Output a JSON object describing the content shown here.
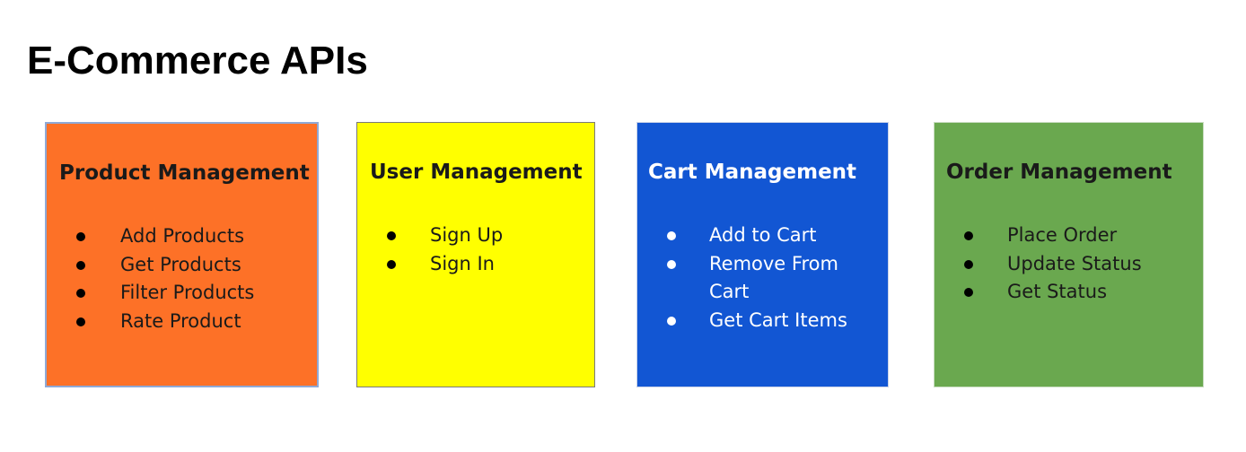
{
  "title": "E-Commerce APIs",
  "cards": [
    {
      "heading": "Product Management",
      "color": "#fd7127",
      "items": [
        "Add Products",
        "Get Products",
        "Filter Products",
        "Rate Product"
      ]
    },
    {
      "heading": "User Management",
      "color": "#ffff00",
      "items": [
        "Sign Up",
        "Sign In"
      ]
    },
    {
      "heading": "Cart Management",
      "color": "#1256d3",
      "items": [
        "Add to Cart",
        "Remove From Cart",
        "Get Cart Items"
      ]
    },
    {
      "heading": "Order Management",
      "color": "#6aa84f",
      "items": [
        "Place Order",
        "Update Status",
        "Get Status"
      ]
    }
  ]
}
